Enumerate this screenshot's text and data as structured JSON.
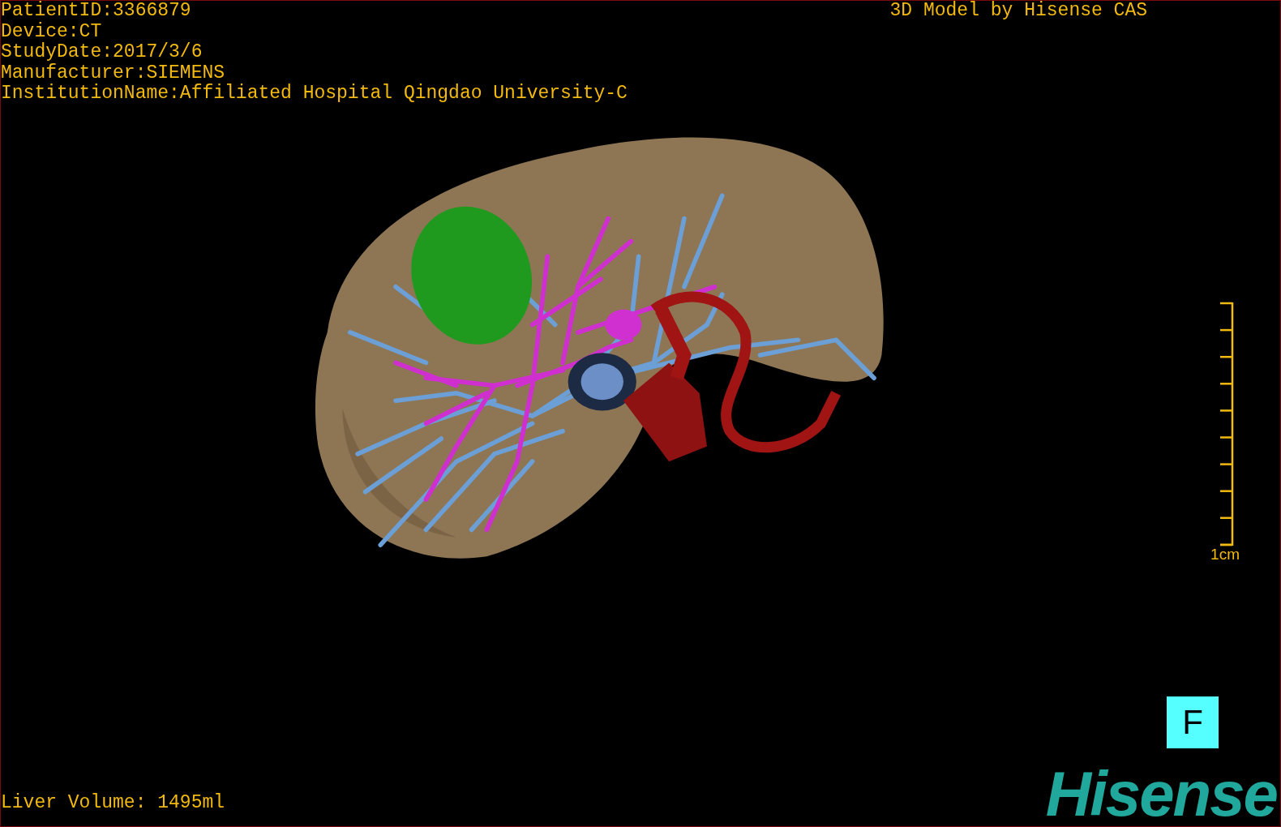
{
  "patient_info": [
    "PatientID:3366879",
    "Device:CT",
    "StudyDate:2017/3/6",
    "Manufacturer:SIEMENS",
    "InstitutionName:Affiliated Hospital Qingdao University-C"
  ],
  "model_credit": "3D Model by Hisense CAS",
  "scale": {
    "label": "1cm"
  },
  "orientation_button": {
    "label": "F"
  },
  "liver_volume": "Liver Volume: 1495ml",
  "logo": "Hisense"
}
